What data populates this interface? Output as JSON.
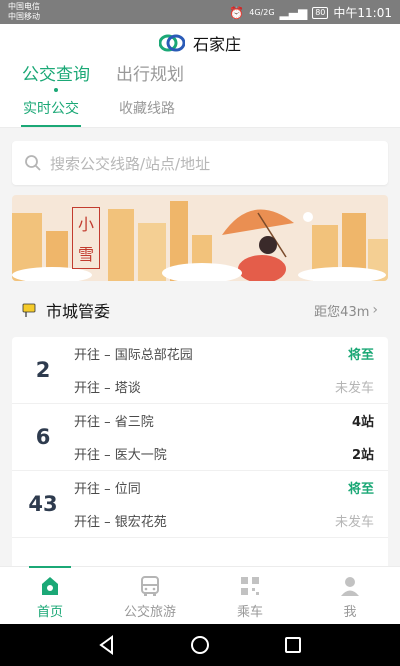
{
  "status": {
    "carrier1": "中国电信",
    "carrier2": "中国移动",
    "network_sig": "4G/2G",
    "battery": "80",
    "time": "中午11:01"
  },
  "header": {
    "city": "石家庄"
  },
  "main_tabs": [
    "公交查询",
    "出行规划"
  ],
  "sub_tabs": [
    "实时公交",
    "收藏线路"
  ],
  "search": {
    "placeholder": "搜索公交线路/站点/地址"
  },
  "banner": {
    "text1": "小",
    "text2": "雪"
  },
  "stop": {
    "name": "市城管委",
    "distance": "距您43m"
  },
  "routes": [
    {
      "num": "2",
      "dirs": [
        {
          "text": "开往 – 国际总部花园",
          "status": "将至",
          "style": "green"
        },
        {
          "text": "开往 – 塔谈",
          "status": "未发车",
          "style": "gray"
        }
      ]
    },
    {
      "num": "6",
      "dirs": [
        {
          "text": "开往 – 省三院",
          "status": "4站",
          "style": "dark"
        },
        {
          "text": "开往 – 医大一院",
          "status": "2站",
          "style": "dark"
        }
      ]
    },
    {
      "num": "43",
      "dirs": [
        {
          "text": "开往 – 位同",
          "status": "将至",
          "style": "green"
        },
        {
          "text": "开往 – 银宏花苑",
          "status": "未发车",
          "style": "gray"
        }
      ]
    }
  ],
  "bottom_nav": [
    "首页",
    "公交旅游",
    "乘车",
    "我"
  ],
  "colors": {
    "accent": "#1ba876",
    "banner_bg": "#f5e6d6",
    "building": "#f2c27b"
  }
}
